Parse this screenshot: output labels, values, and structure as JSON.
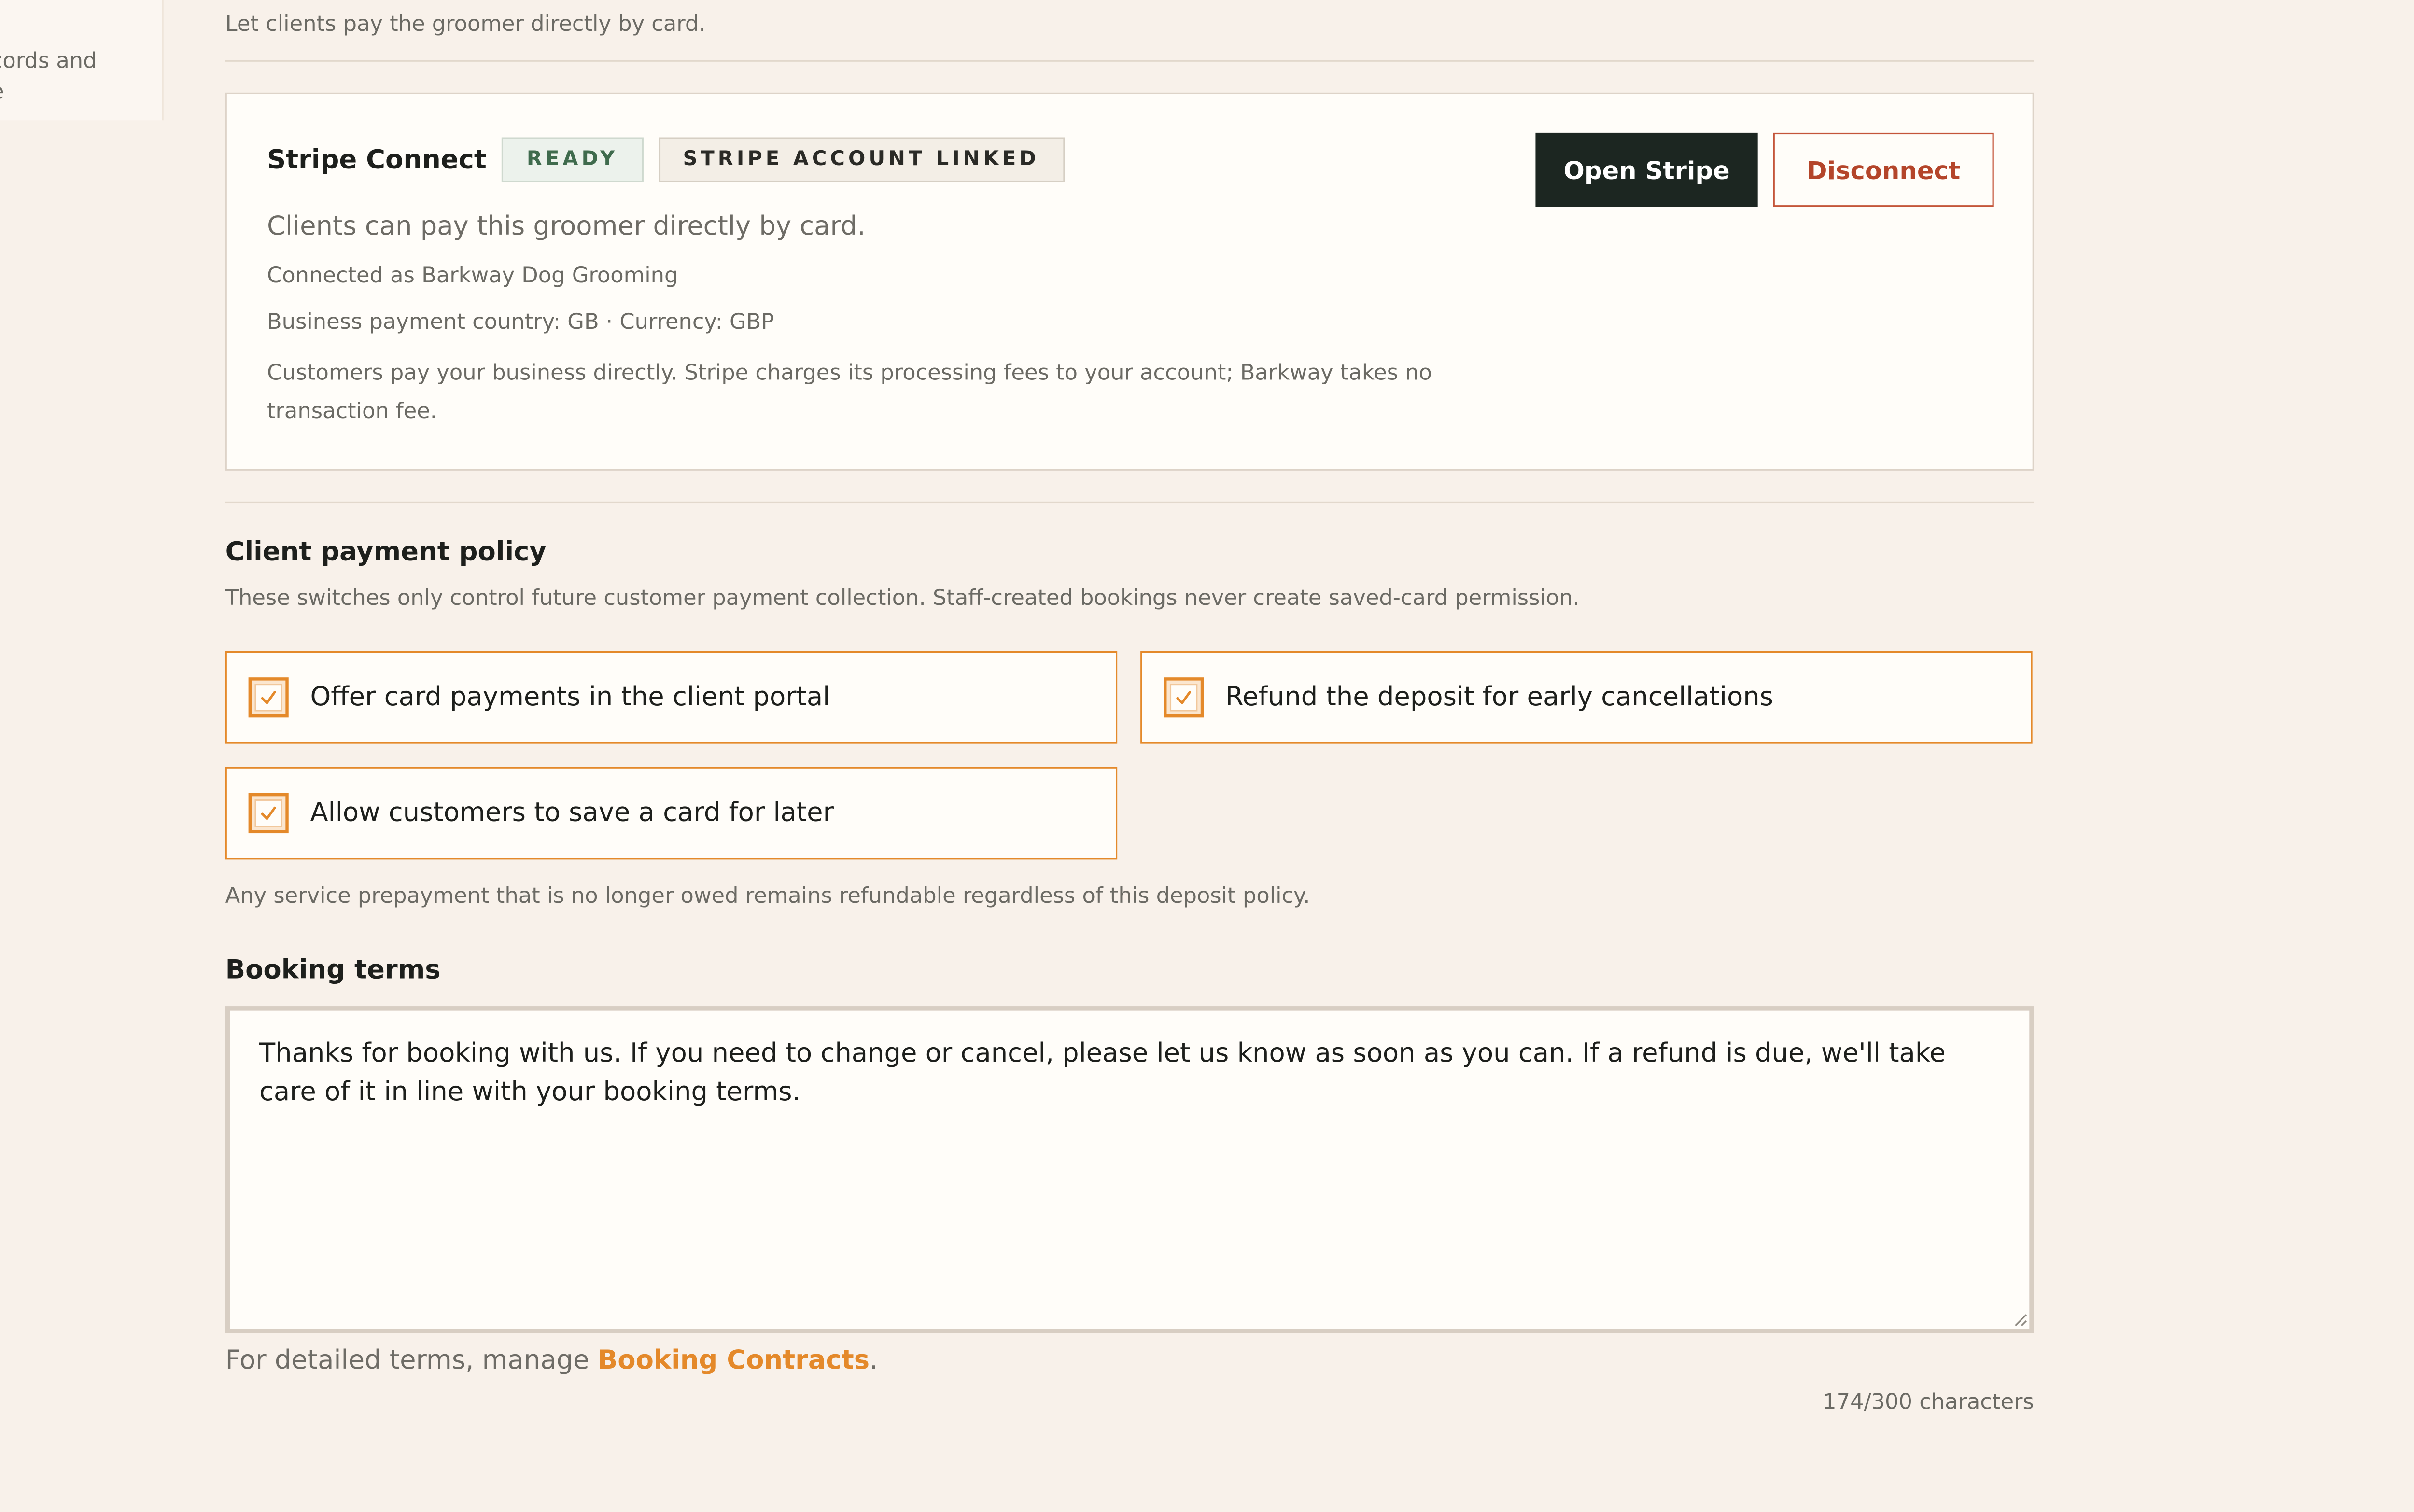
{
  "sidebar": {
    "fragment_text": "cords and\ne"
  },
  "payments": {
    "intro": "Let clients pay the groomer directly by card."
  },
  "stripe": {
    "title": "Stripe Connect",
    "badge_ready": "READY",
    "badge_linked": "STRIPE ACCOUNT LINKED",
    "description": "Clients can pay this groomer directly by card.",
    "connected_as": "Connected as Barkway Dog Grooming",
    "country_currency": "Business payment country: GB · Currency: GBP",
    "fee_note": "Customers pay your business directly. Stripe charges its processing fees to your account; Barkway takes no transaction fee.",
    "open_label": "Open Stripe",
    "disconnect_label": "Disconnect"
  },
  "policy": {
    "title": "Client payment policy",
    "description": "These switches only control future customer payment collection. Staff-created bookings never create saved-card permission.",
    "options": [
      {
        "label": "Offer card payments in the client portal",
        "checked": true
      },
      {
        "label": "Refund the deposit for early cancellations",
        "checked": true
      },
      {
        "label": "Allow customers to save a card for later",
        "checked": true
      }
    ],
    "prepay_note": "Any service prepayment that is no longer owed remains refundable regardless of this deposit policy."
  },
  "terms": {
    "title": "Booking terms",
    "value": "Thanks for booking with us. If you need to change or cancel, please let us know as soon as you can. If a refund is due, we'll take care of it in line with your booking terms.",
    "footer_prefix": "For detailed terms, manage ",
    "footer_link": "Booking Contracts",
    "footer_suffix": ".",
    "char_count": "174/300 characters"
  },
  "colors": {
    "background": "#f8f1ea",
    "accent": "#e4892a",
    "primary_button": "#1c2621",
    "danger": "#b4452a"
  }
}
